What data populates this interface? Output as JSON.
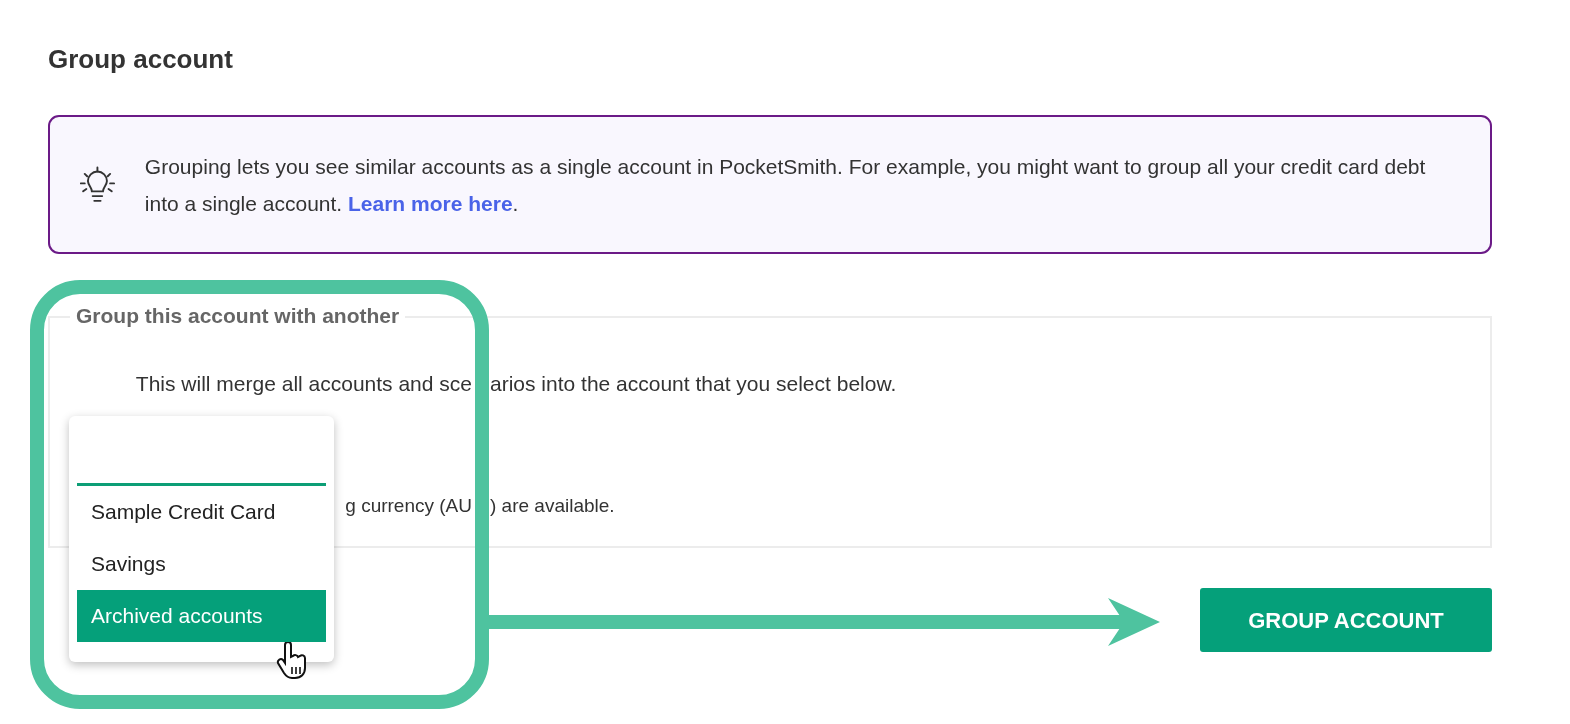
{
  "title": "Group account",
  "info": {
    "text": "Grouping lets you see similar accounts as a single account in PocketSmith. For example, you might want to group all your credit card debt into a single account. ",
    "link": "Learn more here",
    "after": "."
  },
  "group": {
    "legend": "Group this account with another",
    "description": [
      "This will merge all accounts and sce",
      "arios into the account that you select below."
    ],
    "hint": [
      "g currency (AU",
      ") are available."
    ]
  },
  "dropdown": {
    "search_focused": true,
    "items": [
      {
        "label": "Sample Credit Card",
        "selected": false
      },
      {
        "label": "Savings",
        "selected": false
      },
      {
        "label": "Archived accounts",
        "selected": true
      }
    ]
  },
  "button": "GROUP ACCOUNT"
}
